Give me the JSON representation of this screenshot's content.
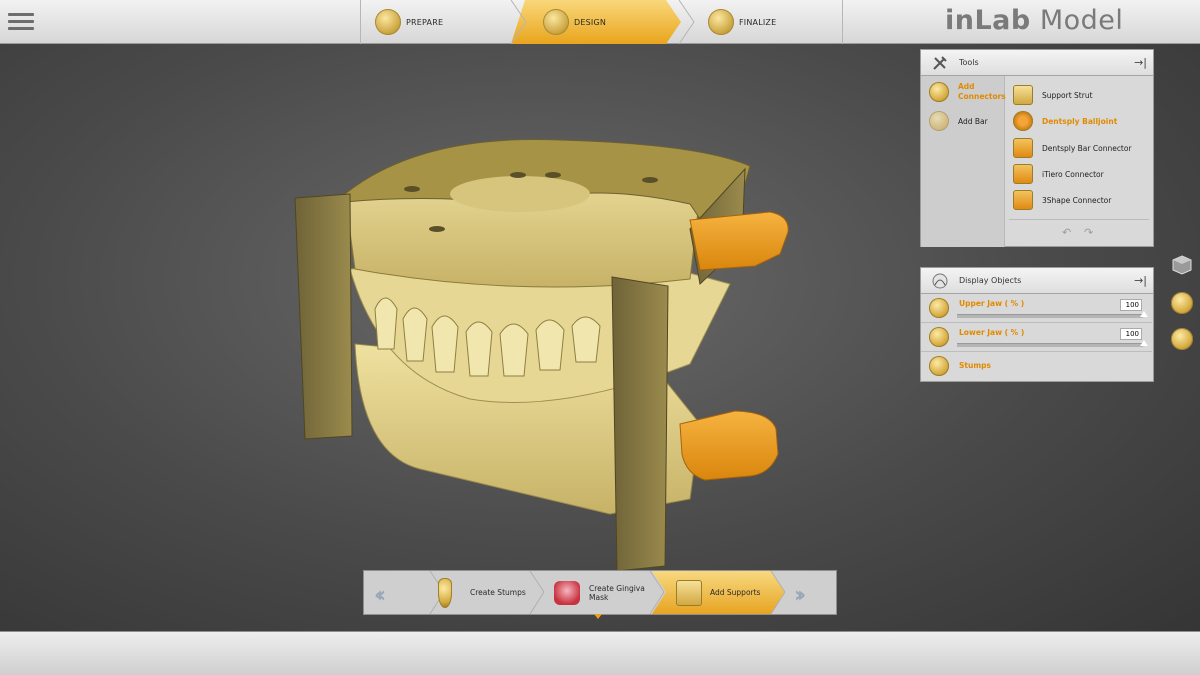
{
  "app": {
    "brand_bold": "inLab",
    "brand_light": " Model"
  },
  "workflow": {
    "steps": [
      {
        "label": "PREPARE",
        "icon": "prepare-icon"
      },
      {
        "label": "DESIGN",
        "icon": "design-icon",
        "active": true
      },
      {
        "label": "FINALIZE",
        "icon": "finalize-icon"
      }
    ]
  },
  "tools_panel": {
    "title": "Tools",
    "categories": [
      {
        "label": "Add\nConnectors",
        "active": true,
        "icon": "add-connectors-icon"
      },
      {
        "label": "Add Bar",
        "active": false,
        "icon": "add-bar-icon"
      }
    ],
    "items": [
      {
        "label": "Support Strut",
        "icon": "support-strut-icon"
      },
      {
        "label": "Dentsply Balljoint",
        "icon": "balljoint-icon",
        "selected": true
      },
      {
        "label": "Dentsply Bar Connector",
        "icon": "bar-connector-icon"
      },
      {
        "label": "iTiero Connector",
        "icon": "itiero-connector-icon"
      },
      {
        "label": "3Shape Connector",
        "icon": "3shape-connector-icon"
      }
    ]
  },
  "display_panel": {
    "title": "Display Objects",
    "rows": [
      {
        "label": "Upper Jaw  ( % )",
        "value": "100"
      },
      {
        "label": "Lower Jaw  ( % )",
        "value": "100"
      },
      {
        "label": "Stumps"
      }
    ]
  },
  "stepper": {
    "steps": [
      {
        "label": "Create Stumps"
      },
      {
        "label": "Create Gingiva Mask"
      },
      {
        "label": "Add Supports",
        "active": true
      }
    ]
  },
  "colors": {
    "accent": "#f0a71f",
    "model": "#d8c884",
    "connector": "#ef9d1c"
  }
}
